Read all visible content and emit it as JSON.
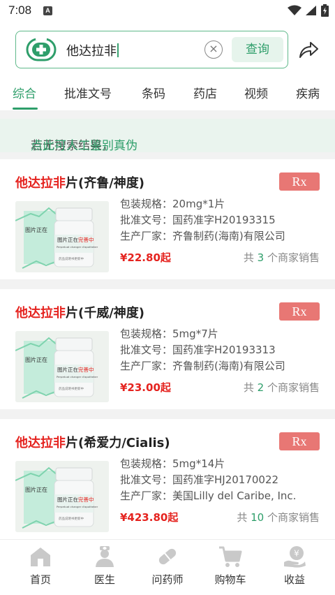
{
  "status_bar": {
    "time": "7:08",
    "app_icon_letter": "A"
  },
  "search": {
    "query": "他达拉非",
    "button_label": "查询"
  },
  "tabs": [
    {
      "label": "综合",
      "active": true
    },
    {
      "label": "批准文号"
    },
    {
      "label": "条码"
    },
    {
      "label": "药店"
    },
    {
      "label": "视频"
    },
    {
      "label": "疾病"
    }
  ],
  "notice": {
    "text": "若无搜索结果，",
    "link": "点此可人工鉴别真伪"
  },
  "labels": {
    "spec": "包装规格：",
    "approval": "批准文号：",
    "maker": "生产厂家：",
    "sellers_prefix": "共 ",
    "sellers_suffix": " 个商家销售"
  },
  "products": [
    {
      "name_highlight": "他达拉非",
      "name_rest": "片(齐鲁/神度)",
      "badge": "Rx",
      "spec": "20mg*1片",
      "approval": "国药准字H20193315",
      "maker": "齐鲁制药(海南)有限公司",
      "price": "¥22.80起",
      "seller_count": "3"
    },
    {
      "name_highlight": "他达拉非",
      "name_rest": "片(千威/神度)",
      "badge": "Rx",
      "spec": "5mg*7片",
      "approval": "国药准字H20193313",
      "maker": "齐鲁制药(海南)有限公司",
      "price": "¥23.00起",
      "seller_count": "2"
    },
    {
      "name_highlight": "他达拉非",
      "name_rest": "片(希爱力/Cialis)",
      "badge": "Rx",
      "spec": "5mg*14片",
      "approval": "国药准字HJ20170022",
      "maker": "美国Lilly del Caribe, Inc.",
      "price": "¥423.80起",
      "seller_count": "10"
    }
  ],
  "image_placeholder": {
    "title_a": "图片正在",
    "title_b": "完善中",
    "subtitle": "Perpetuat changer d'apotheker",
    "caption": "药品说明书更新中"
  },
  "bottom_nav": [
    {
      "label": "首页",
      "icon": "home-icon"
    },
    {
      "label": "医生",
      "icon": "doctor-icon"
    },
    {
      "label": "问药师",
      "icon": "pill-icon"
    },
    {
      "label": "购物车",
      "icon": "cart-icon"
    },
    {
      "label": "收益",
      "icon": "income-icon"
    }
  ],
  "colors": {
    "accent": "#2e9e6a",
    "price": "#e5231f",
    "rx_badge": "#e87774",
    "notice_bg": "#eaf4ee"
  }
}
